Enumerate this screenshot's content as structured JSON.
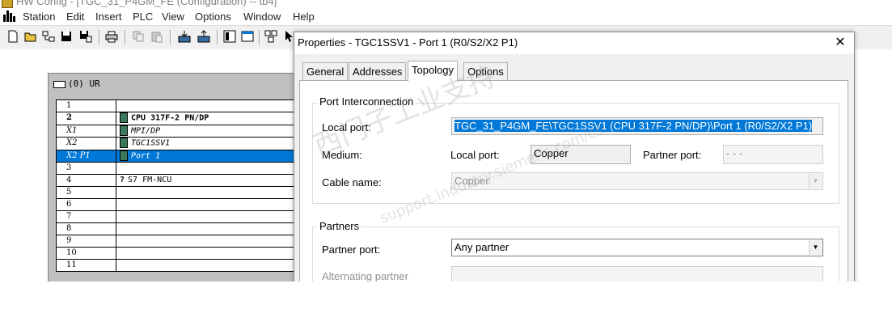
{
  "app": {
    "title": "HW Config - [TGC_31_P4GM_FE (Configuration) -- tb4]"
  },
  "menu": [
    "Station",
    "Edit",
    "Insert",
    "PLC",
    "View",
    "Options",
    "Window",
    "Help"
  ],
  "toolbar": {
    "icons": [
      "new-icon",
      "open-icon",
      "network-icon",
      "save-icon",
      "save-compile-icon",
      "print-icon",
      "copy-icon",
      "paste-icon",
      "download-icon",
      "upload-icon",
      "catalog-icon",
      "properties-icon",
      "network-view-icon",
      "help-pointer-icon"
    ]
  },
  "rack": {
    "title": "(0) UR",
    "rows": [
      {
        "slot": "1",
        "module": ""
      },
      {
        "slot": "2",
        "module": "CPU 317F-2 PN/DP"
      },
      {
        "slot": "X1",
        "module": "MPI/DP"
      },
      {
        "slot": "X2",
        "module": "TGC1SSV1"
      },
      {
        "slot": "X2 P1",
        "module": "Port 1"
      },
      {
        "slot": "3",
        "module": ""
      },
      {
        "slot": "4",
        "module": "S7 FM-NCU"
      },
      {
        "slot": "5",
        "module": ""
      },
      {
        "slot": "6",
        "module": ""
      },
      {
        "slot": "7",
        "module": ""
      },
      {
        "slot": "8",
        "module": ""
      },
      {
        "slot": "9",
        "module": ""
      },
      {
        "slot": "10",
        "module": ""
      },
      {
        "slot": "11",
        "module": ""
      }
    ]
  },
  "dialog": {
    "title": "Properties - TGC1SSV1 - Port 1 (R0/S2/X2 P1)",
    "tabs": [
      "General",
      "Addresses",
      "Topology",
      "Options"
    ],
    "active_tab": "Topology",
    "port_interconnection": {
      "group_label": "Port Interconnection",
      "local_port_label": "Local port:",
      "local_port_value": "TGC_31_P4GM_FE\\TGC1SSV1 (CPU 317F-2 PN/DP)\\Port 1 (R0/S2/X2 P1)",
      "medium_label": "Medium:",
      "medium_local_label": "Local port:",
      "medium_local_value": "Copper",
      "medium_partner_label": "Partner port:",
      "medium_partner_value": "- - -",
      "cable_label": "Cable name:",
      "cable_value": "Copper"
    },
    "partners": {
      "group_label": "Partners",
      "partner_port_label": "Partner port:",
      "partner_port_value": "Any partner",
      "alternating_label": "Alternating partner"
    }
  },
  "watermark": {
    "line1": "西门子工业支持",
    "line2": "support.industry.siemens.com/cs"
  }
}
